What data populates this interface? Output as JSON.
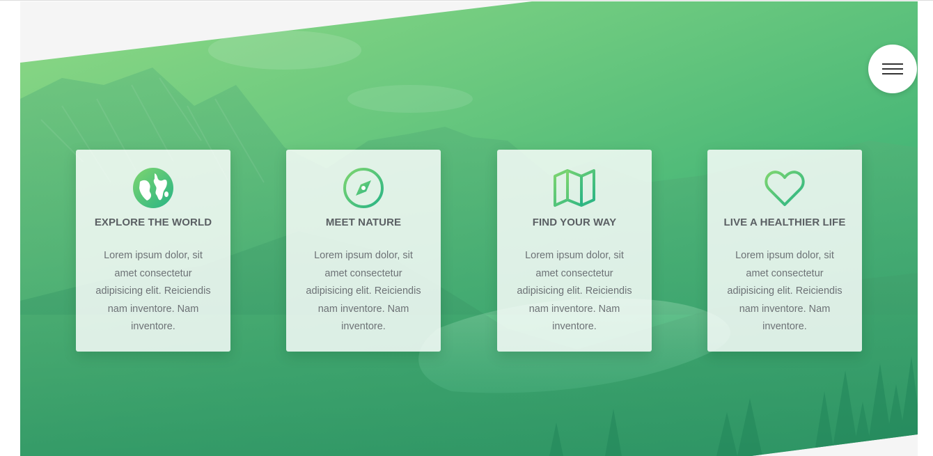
{
  "menu": {
    "icon": "hamburger-menu-icon"
  },
  "cards": [
    {
      "icon": "globe-icon",
      "title": "EXPLORE THE WORLD",
      "text": "Lorem ipsum dolor, sit amet consectetur adipisicing elit. Reiciendis nam inventore. Nam inventore."
    },
    {
      "icon": "compass-icon",
      "title": "MEET NATURE",
      "text": "Lorem ipsum dolor, sit amet consectetur adipisicing elit. Reiciendis nam inventore. Nam inventore."
    },
    {
      "icon": "map-icon",
      "title": "FIND YOUR WAY",
      "text": "Lorem ipsum dolor, sit amet consectetur adipisicing elit. Reiciendis nam inventore. Nam inventore."
    },
    {
      "icon": "heart-icon",
      "title": "LIVE A HEALTHIER LIFE",
      "text": "Lorem ipsum dolor, sit amet consectetur adipisicing elit. Reiciendis nam inventore. Nam inventore."
    }
  ],
  "colors": {
    "gradient_light": "#7ed56f",
    "gradient_dark": "#28b485",
    "card_text": "#6d7276",
    "card_title": "#5a5f63"
  }
}
